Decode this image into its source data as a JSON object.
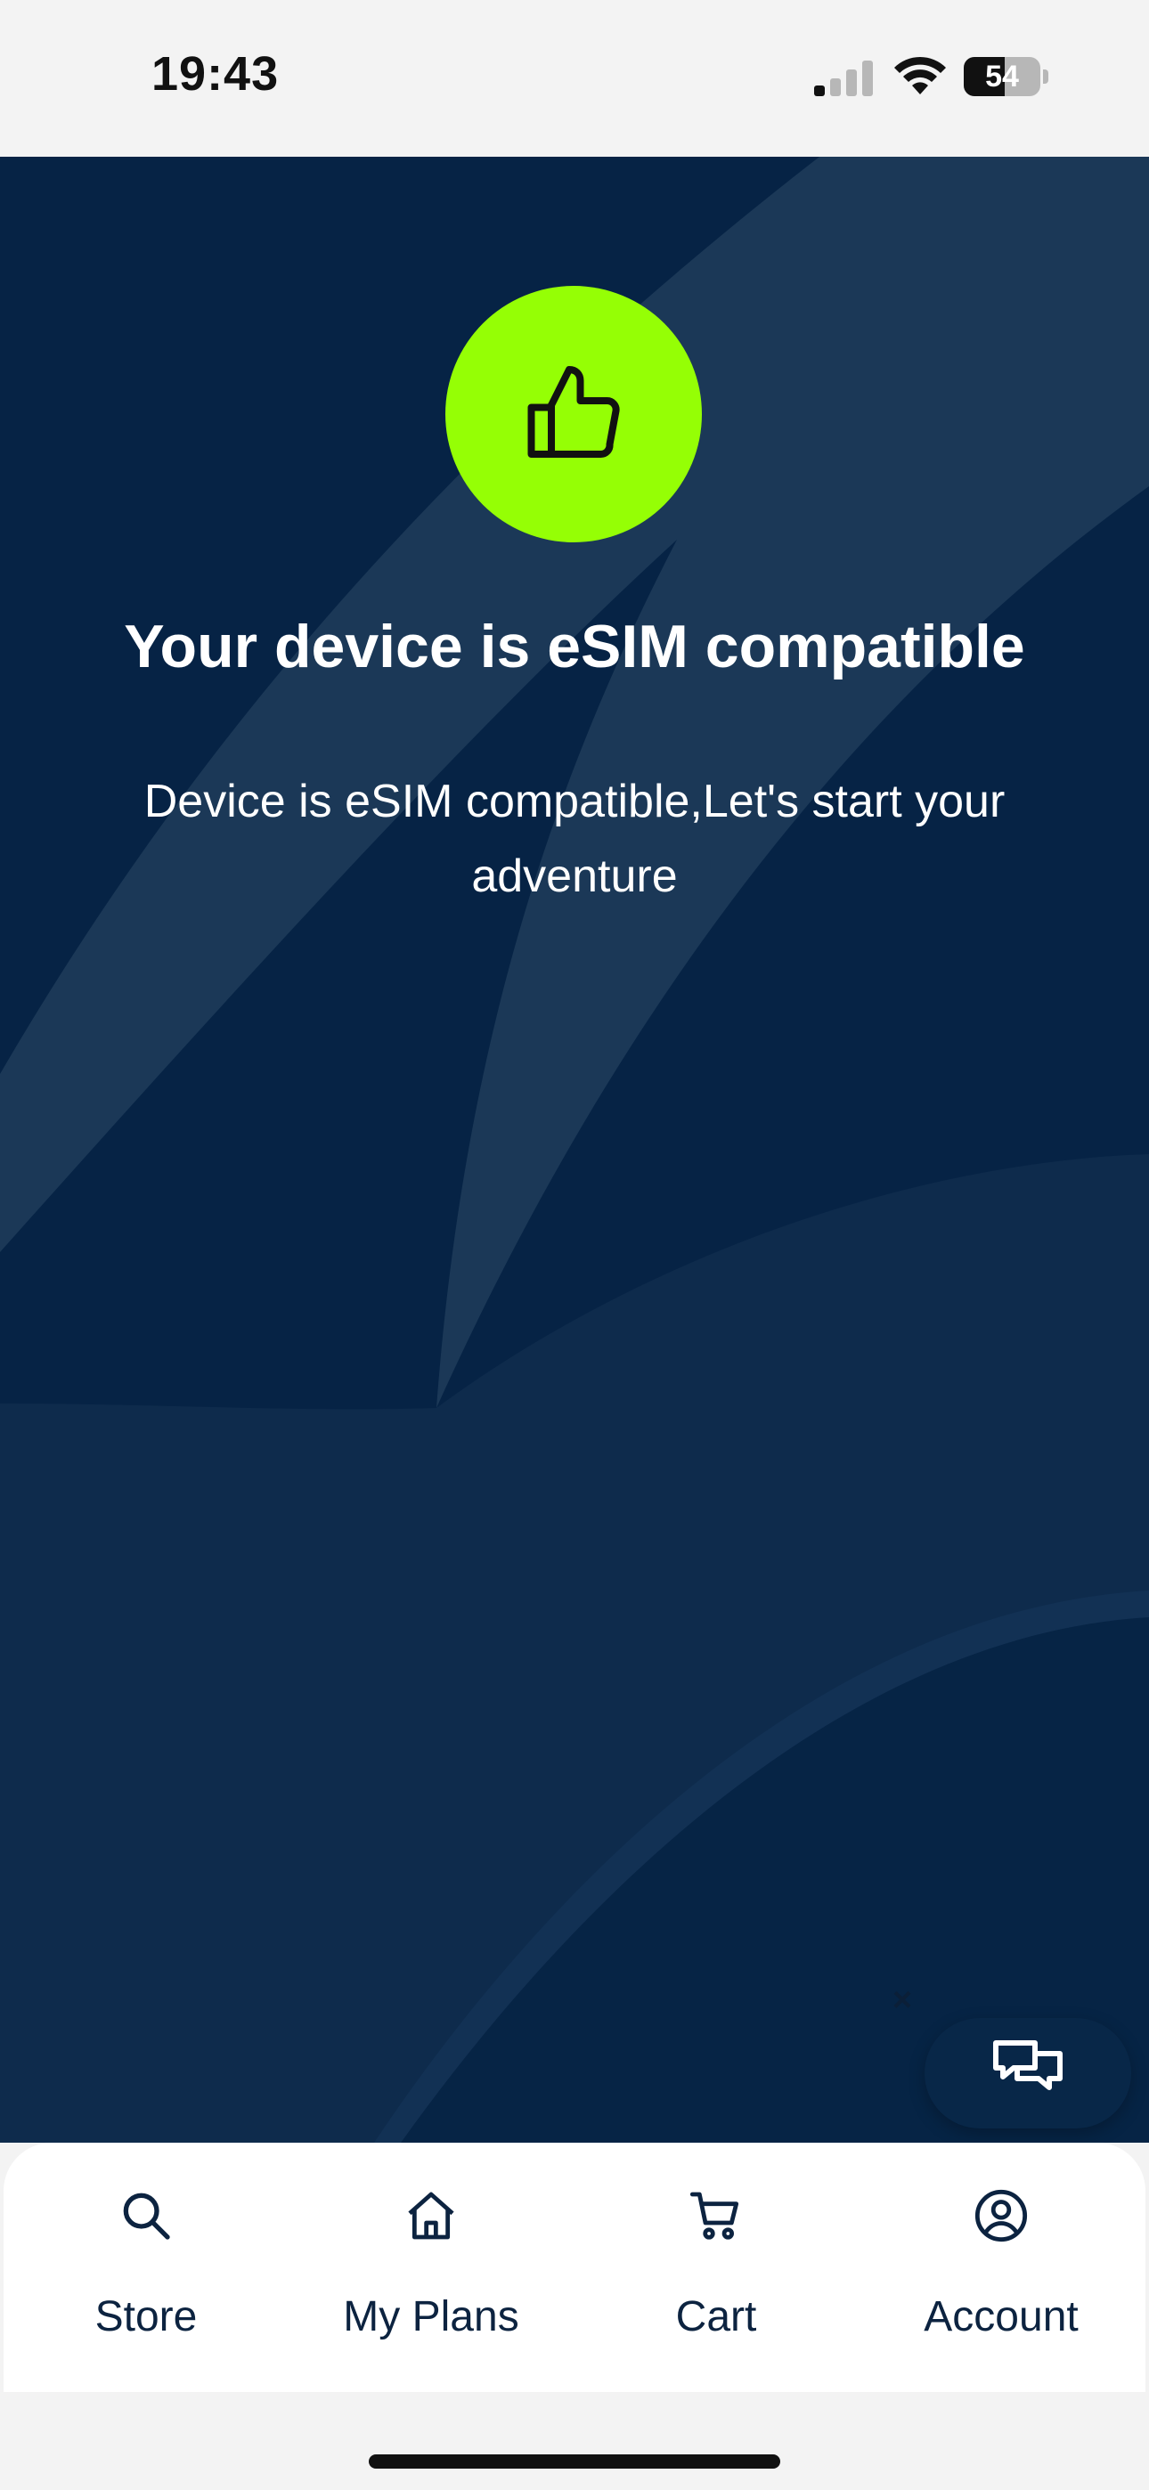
{
  "status_bar": {
    "time": "19:43",
    "battery_percent": "54",
    "battery_level": 0.54,
    "signal_bars": 1,
    "icons": [
      "signal-icon",
      "wifi-icon",
      "battery-icon"
    ]
  },
  "hero": {
    "icon": "thumbs-up-icon",
    "title": "Your device is eSIM compatible",
    "subtitle": "Device is eSIM compatible,Let's start your adventure"
  },
  "chat": {
    "icon": "chat-bubbles-icon",
    "dismiss_icon": "close-icon",
    "dismiss_label": "×"
  },
  "bottom_nav": {
    "items": [
      {
        "label": "Store",
        "icon": "search-icon"
      },
      {
        "label": "My Plans",
        "icon": "home-icon"
      },
      {
        "label": "Cart",
        "icon": "cart-icon"
      },
      {
        "label": "Account",
        "icon": "account-icon"
      }
    ]
  },
  "colors": {
    "hero_background": "#062345",
    "accent_green": "#95ff05",
    "nav_text": "#0c2340"
  }
}
